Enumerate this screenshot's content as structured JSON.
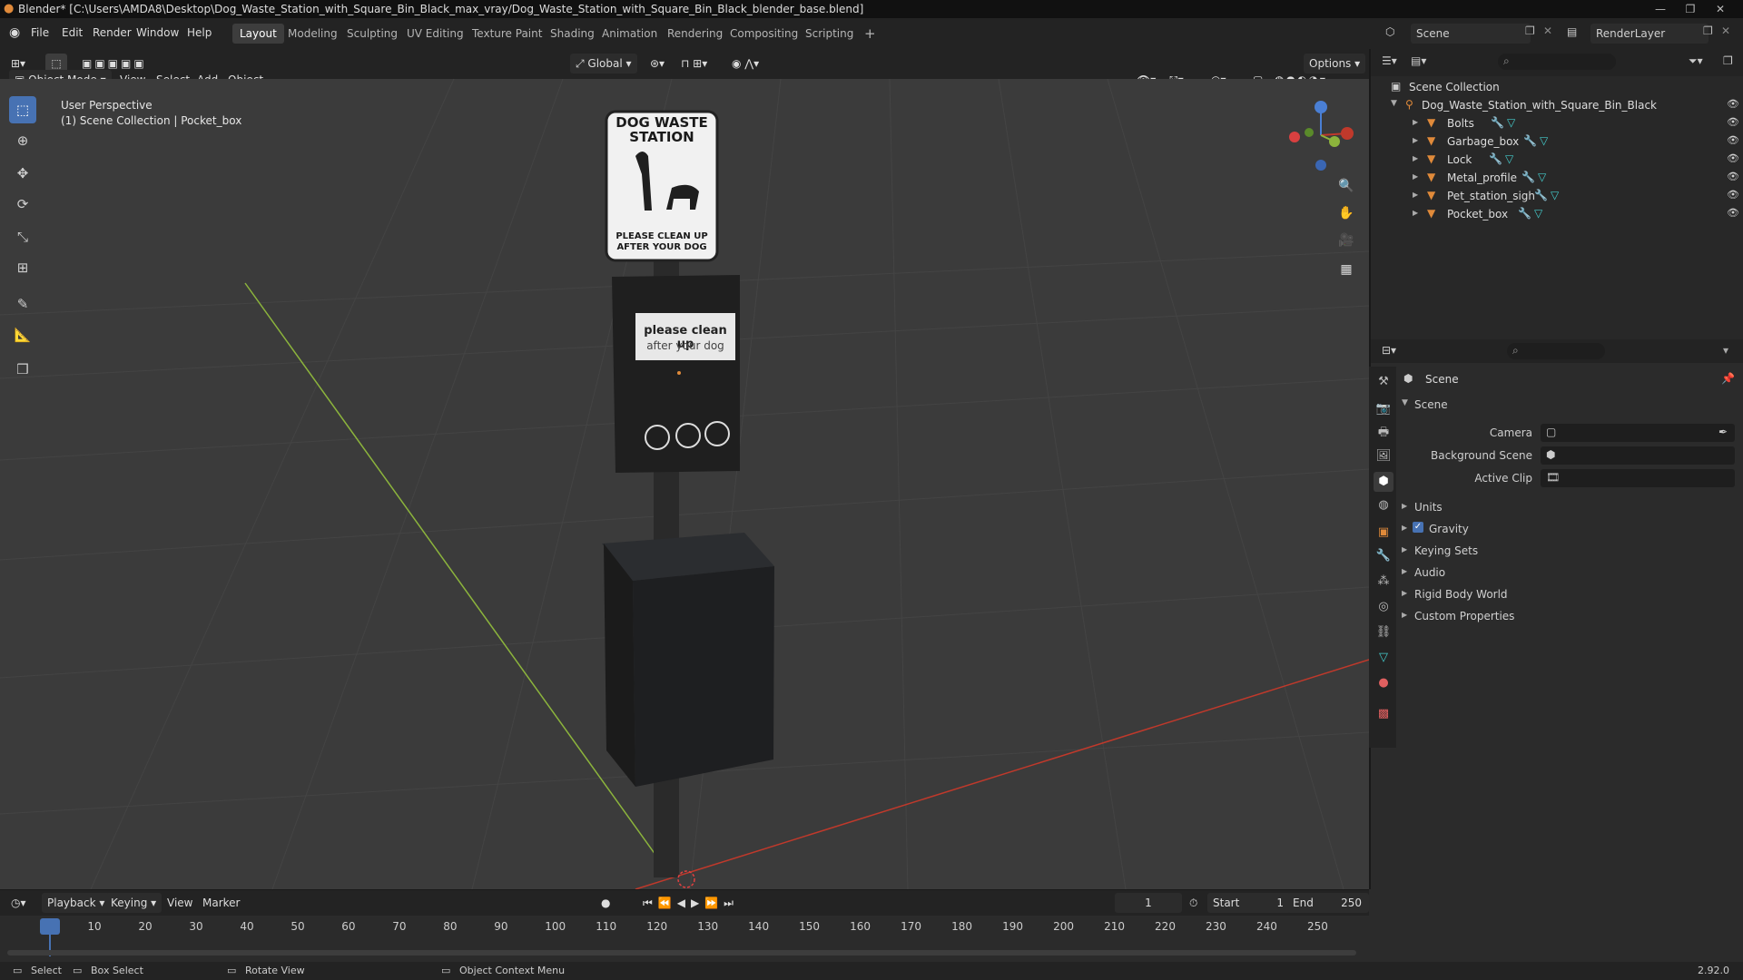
{
  "window": {
    "title": "Blender* [C:\\Users\\AMDA8\\Desktop\\Dog_Waste_Station_with_Square_Bin_Black_max_vray/Dog_Waste_Station_with_Square_Bin_Black_blender_base.blend]"
  },
  "menu": {
    "items": [
      "File",
      "Edit",
      "Render",
      "Window",
      "Help"
    ]
  },
  "workspaces": [
    "Layout",
    "Modeling",
    "Sculpting",
    "UV Editing",
    "Texture Paint",
    "Shading",
    "Animation",
    "Rendering",
    "Compositing",
    "Scripting"
  ],
  "topright": {
    "scene": "Scene",
    "render_layer": "RenderLayer"
  },
  "viewport_header": {
    "mode": "Object Mode",
    "view": "View",
    "select": "Select",
    "add": "Add",
    "object": "Object",
    "orientation": "Global",
    "options": "Options"
  },
  "viewport": {
    "perspective": "User Perspective",
    "collection": "(1) Scene Collection | Pocket_box",
    "sign_title": "DOG WASTE STATION",
    "sign_footer": "PLEASE CLEAN UP AFTER YOUR DOG",
    "dispenser_line1": "please clean up",
    "dispenser_line2": "after your dog"
  },
  "outliner": {
    "root": "Scene Collection",
    "collection": "Dog_Waste_Station_with_Square_Bin_Black",
    "objects": [
      "Bolts",
      "Garbage_box",
      "Lock",
      "Metal_profile",
      "Pet_station_sigh",
      "Pocket_box"
    ]
  },
  "properties": {
    "context": "Scene",
    "section": "Scene",
    "camera_label": "Camera",
    "background_label": "Background Scene",
    "clip_label": "Active Clip",
    "panels": [
      "Units",
      "Gravity",
      "Keying Sets",
      "Audio",
      "Rigid Body World",
      "Custom Properties"
    ]
  },
  "timeline": {
    "playback": "Playback",
    "keying": "Keying",
    "view": "View",
    "marker": "Marker",
    "current_frame": "1",
    "start_label": "Start",
    "start": "1",
    "end_label": "End",
    "end": "250",
    "ticks": [
      "1",
      "10",
      "20",
      "30",
      "40",
      "50",
      "60",
      "70",
      "80",
      "90",
      "100",
      "110",
      "120",
      "130",
      "140",
      "150",
      "160",
      "170",
      "180",
      "190",
      "200",
      "210",
      "220",
      "230",
      "240",
      "250"
    ]
  },
  "statusbar": {
    "select": "Select",
    "box_select": "Box Select",
    "rotate": "Rotate View",
    "context_menu": "Object Context Menu",
    "version": "2.92.0"
  },
  "colors": {
    "accent": "#4772b3",
    "viewport_bg": "#3b3b3b",
    "axis_x": "#c0392b",
    "axis_y": "#8cb43c",
    "object_orange": "#e08a3a"
  }
}
